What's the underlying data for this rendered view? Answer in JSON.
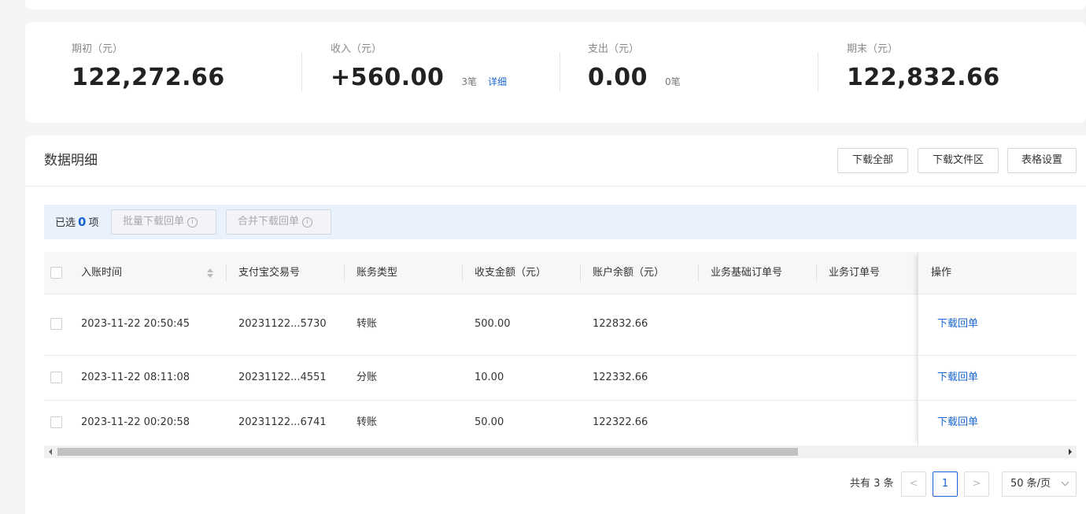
{
  "summary": {
    "opening": {
      "label": "期初（元）",
      "value": "122,272.66"
    },
    "income": {
      "label": "收入（元）",
      "value": "+560.00",
      "count": "3笔",
      "detail": "详细"
    },
    "expense": {
      "label": "支出（元）",
      "value": "0.00",
      "count": "0笔"
    },
    "closing": {
      "label": "期末（元）",
      "value": "122,832.66"
    }
  },
  "panel": {
    "title": "数据明细",
    "buttons": {
      "download_all": "下载全部",
      "download_area": "下载文件区",
      "table_settings": "表格设置"
    }
  },
  "selection": {
    "prefix": "已选",
    "count": "0",
    "suffix": "项",
    "batch_download": "批量下载回单",
    "merge_download": "合并下载回单"
  },
  "table": {
    "columns": [
      "入账时间",
      "支付宝交易号",
      "账务类型",
      "收支金额（元）",
      "账户余额（元）",
      "业务基础订单号",
      "业务订单号",
      "操作"
    ],
    "rows": [
      {
        "time": "2023-11-22 20:50:45",
        "trade_no": "20231122...5730",
        "type": "转账",
        "amount": "500.00",
        "balance": "122832.66",
        "base_order": "",
        "order": "",
        "action": "下载回单"
      },
      {
        "time": "2023-11-22 08:11:08",
        "trade_no": "20231122...4551",
        "type": "分账",
        "amount": "10.00",
        "balance": "122332.66",
        "base_order": "",
        "order": "",
        "action": "下载回单"
      },
      {
        "time": "2023-11-22 00:20:58",
        "trade_no": "20231122...6741",
        "type": "转账",
        "amount": "50.00",
        "balance": "122322.66",
        "base_order": "",
        "order": "",
        "action": "下载回单"
      }
    ]
  },
  "pagination": {
    "total": "共有 3 条",
    "prev": "<",
    "current": "1",
    "next": ">",
    "page_size": "50 条/页"
  },
  "colors": {
    "accent": "#1a66d1",
    "selection_bg": "#e9f1fd"
  }
}
